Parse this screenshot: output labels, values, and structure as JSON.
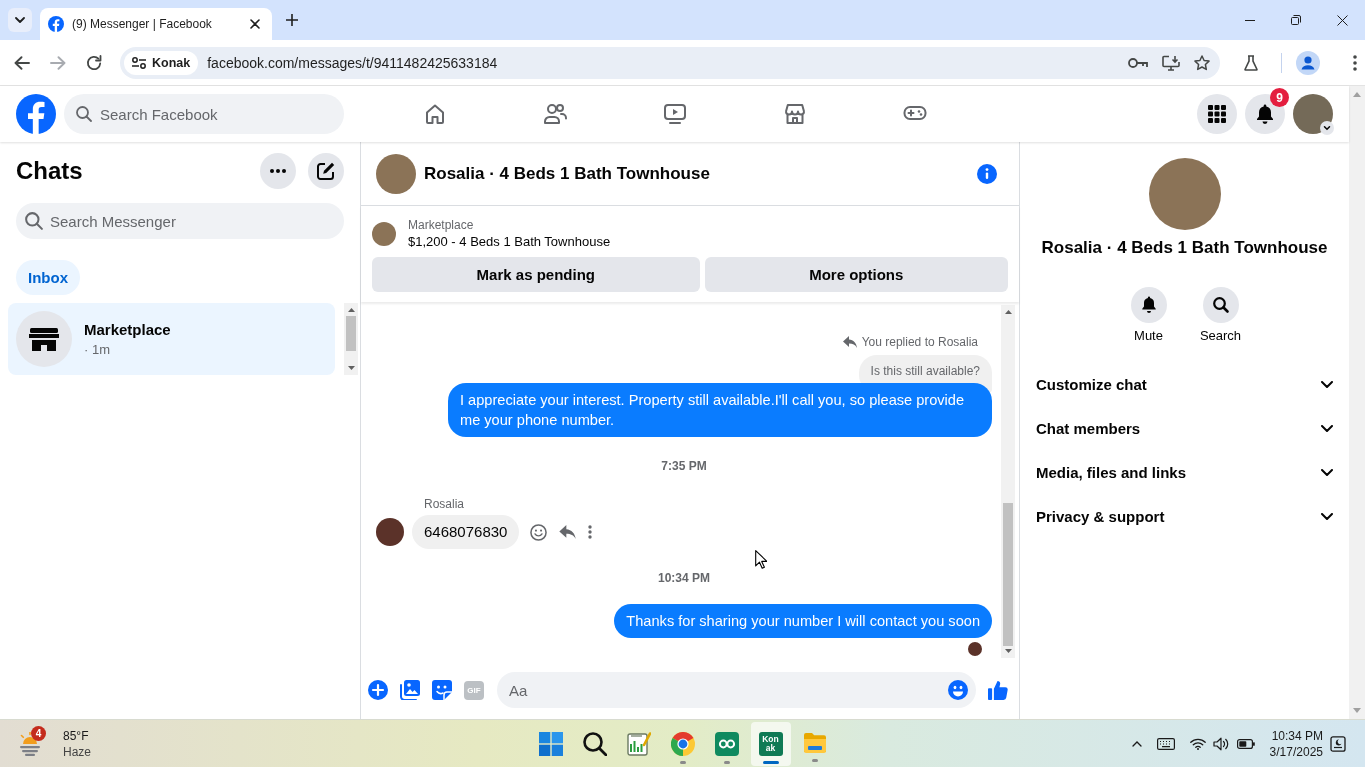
{
  "browser": {
    "tabs": [
      {
        "title": "(9) Messenger | Facebook",
        "selected": true
      }
    ],
    "forward_disabled": true,
    "site_chip": "Konak",
    "url": "facebook.com/messages/t/9411482425633184"
  },
  "header": {
    "search": {
      "placeholder": "Search Facebook"
    },
    "nav": [
      {
        "kind": "home",
        "selected": false
      },
      {
        "kind": "friends",
        "selected": false
      },
      {
        "kind": "video",
        "selected": false
      },
      {
        "kind": "marketplace",
        "selected": false
      },
      {
        "kind": "gaming",
        "selected": false
      }
    ],
    "notification_count": "9"
  },
  "chats": {
    "title": "Chats",
    "search": {
      "placeholder": "Search Messenger"
    },
    "filters": [
      {
        "label": "Inbox",
        "selected": true
      }
    ],
    "conversations": [
      {
        "name": "Marketplace",
        "meta": "· 1m",
        "selected": true
      }
    ]
  },
  "conversation": {
    "title": "Rosalia · 4 Beds 1 Bath Townhouse",
    "listing": {
      "source": "Marketplace",
      "summary": "$1,200 - 4 Beds 1 Bath Townhouse"
    },
    "actions": [
      "Mark as pending",
      "More options"
    ],
    "messages": [
      {
        "kind": "reply_note",
        "text": "You replied to Rosalia"
      },
      {
        "kind": "quoted",
        "text": "Is this still available?"
      },
      {
        "kind": "outgoing",
        "text": "I appreciate your interest. Property still available.I'll call you, so please provide me your phone number.",
        "seen": false
      },
      {
        "kind": "timestamp",
        "text": "7:35 PM"
      },
      {
        "kind": "incoming",
        "sender": "Rosalia",
        "text": "6468076830"
      },
      {
        "kind": "timestamp",
        "text": "10:34 PM"
      },
      {
        "kind": "outgoing",
        "text": "Thanks for sharing your number I will contact you soon",
        "seen": true
      }
    ],
    "composer": {
      "placeholder": "Aa",
      "gif_label": "GIF"
    }
  },
  "details": {
    "name": "Rosalia · 4 Beds 1 Bath Townhouse",
    "actions": [
      {
        "kind": "mute",
        "label": "Mute"
      },
      {
        "kind": "search",
        "label": "Search"
      }
    ],
    "sections": [
      {
        "label": "Customize chat",
        "expanded": false
      },
      {
        "label": "Chat members",
        "expanded": false
      },
      {
        "label": "Media, files and links",
        "expanded": false
      },
      {
        "label": "Privacy & support",
        "expanded": false
      }
    ]
  },
  "taskbar": {
    "weather": {
      "badge": "4",
      "temperature": "85°F",
      "condition": "Haze"
    },
    "apps": [
      {
        "kind": "start",
        "running": false,
        "selected": false
      },
      {
        "kind": "search",
        "running": false,
        "selected": false
      },
      {
        "kind": "notepad",
        "running": false,
        "selected": false
      },
      {
        "kind": "chrome",
        "running": true,
        "selected": false
      },
      {
        "kind": "green-app",
        "running": true,
        "selected": false
      },
      {
        "kind": "konak",
        "label": "Kon ak",
        "running": true,
        "selected": true
      },
      {
        "kind": "explorer",
        "running": true,
        "selected": false
      }
    ],
    "clock": {
      "time": "10:34 PM",
      "date": "3/17/2025"
    }
  }
}
